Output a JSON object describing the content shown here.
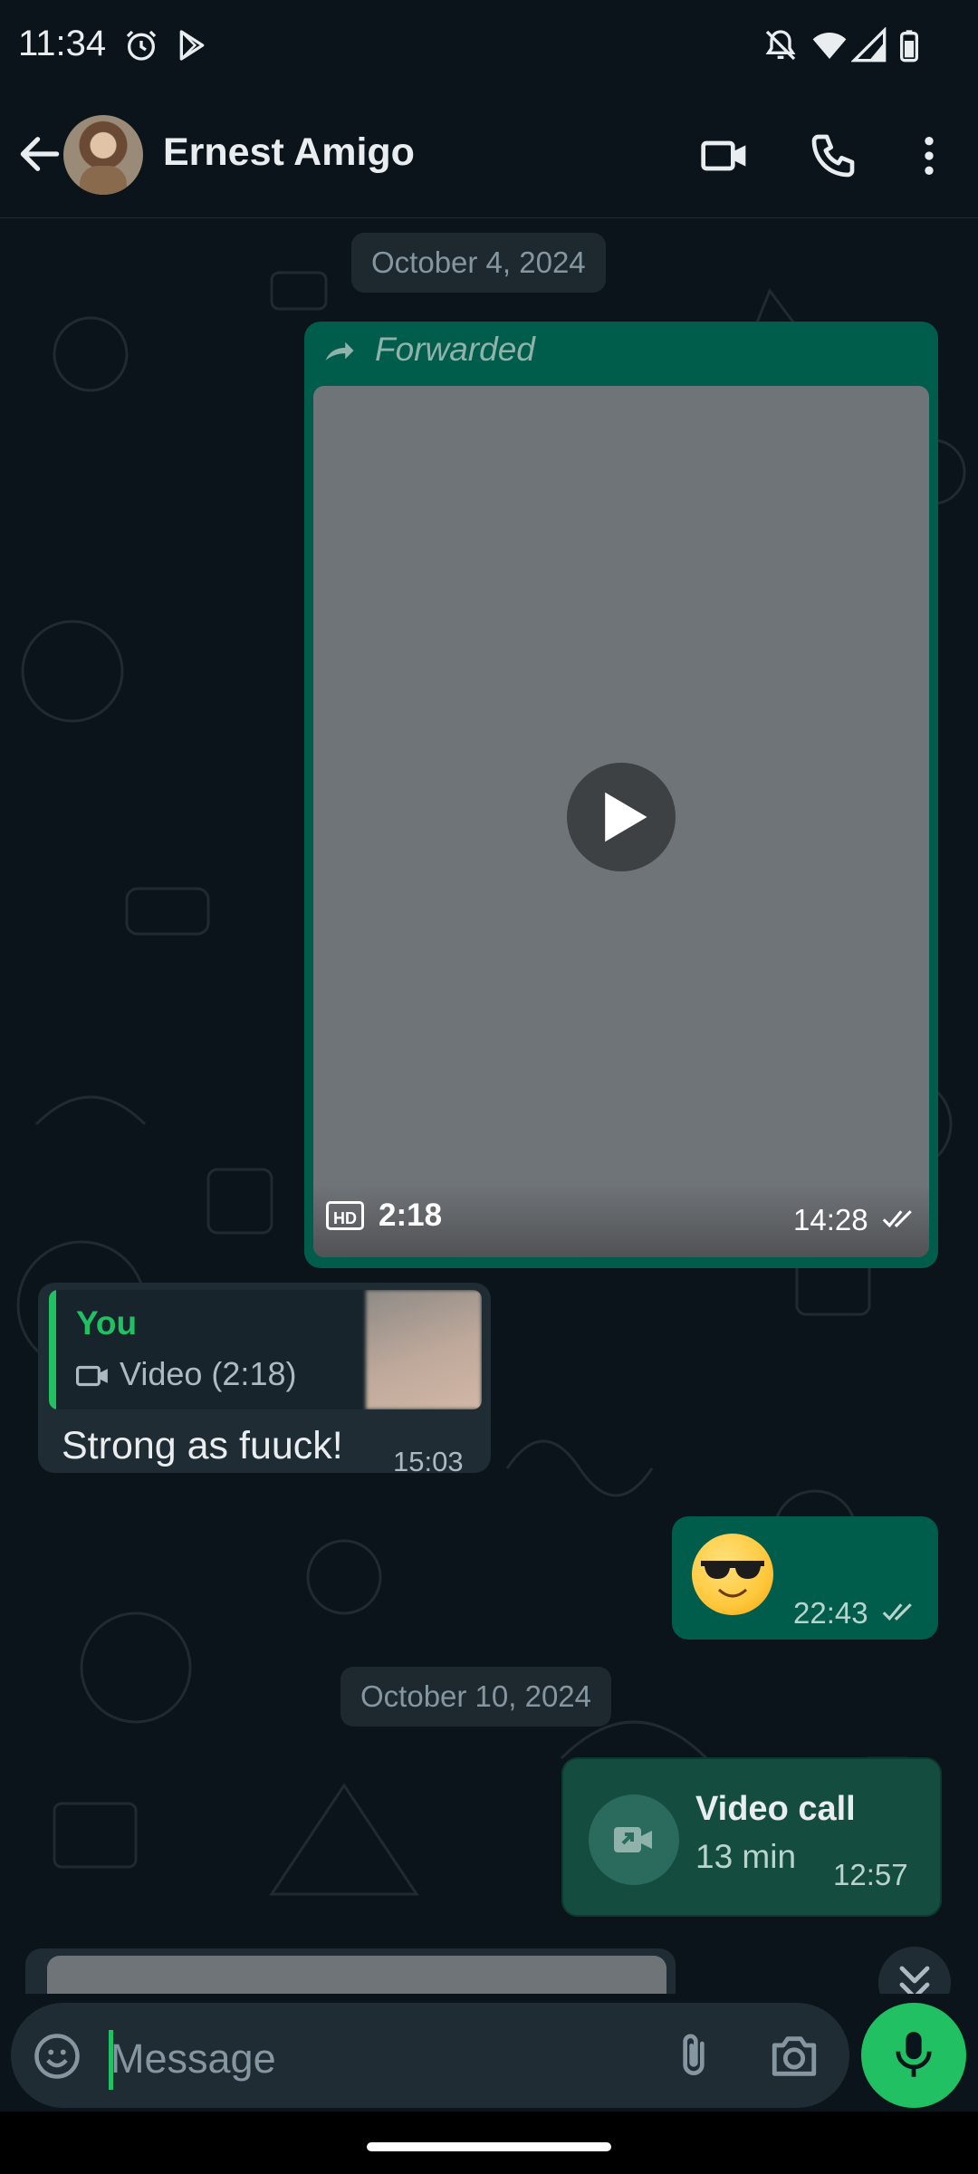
{
  "status_bar": {
    "time": "11:34"
  },
  "header": {
    "contact_name": "Ernest Amigo"
  },
  "messages": {
    "date1": "October 4, 2024",
    "video_forward": {
      "forwarded_label": "Forwarded",
      "hd_label": "HD",
      "duration": "2:18",
      "time": "14:28"
    },
    "reply": {
      "quoted_author": "You",
      "quoted_text": "Video (2:18)",
      "text": "Strong as fuuck!",
      "time": "15:03"
    },
    "emoji": {
      "time": "22:43"
    },
    "date2": "October 10, 2024",
    "video_call": {
      "title": "Video call",
      "duration": "13 min",
      "time": "12:57"
    }
  },
  "composer": {
    "placeholder": "Message"
  },
  "colors": {
    "accent": "#21c063",
    "outgoing_bubble": "#005c4b",
    "incoming_bubble": "#1f2c34",
    "background": "#0b141a"
  }
}
